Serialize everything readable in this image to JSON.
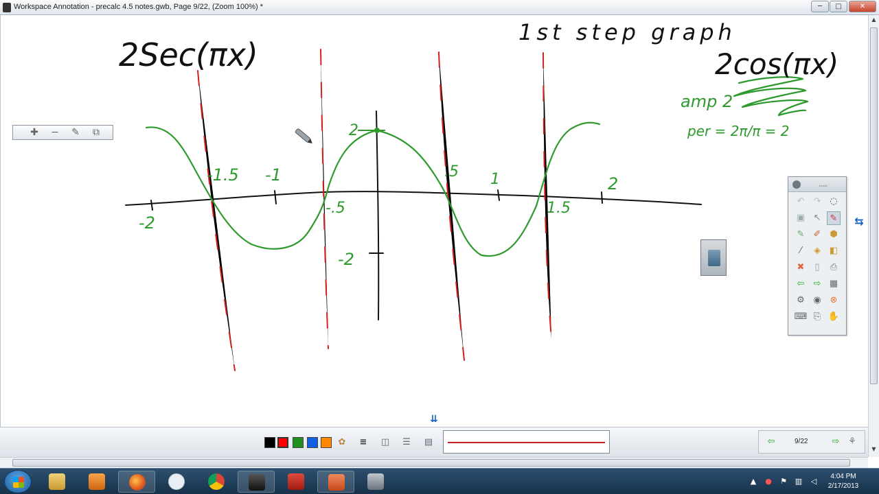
{
  "window": {
    "title": "Workspace Annotation - precalc 4.5 notes.gwb, Page 9/22, (Zoom 100%) *",
    "minimize_glyph": "─",
    "maximize_glyph": "□",
    "close_glyph": "✕"
  },
  "handwriting": {
    "main_function": "2Sec(πx)",
    "step_note": "1st step graph",
    "helper_function": "2cos(πx)",
    "amplitude_note": "amp 2",
    "period_note": "per = 2π/π = 2",
    "axis_labels": {
      "x_neg2": "-2",
      "x_neg1_5": "-1.5",
      "x_neg1": "-1",
      "x_neg0_5": "-.5",
      "x_pos0_5": ".5",
      "x_pos1": "1",
      "x_pos1_5": "1.5",
      "x_pos2": "2",
      "y_pos2": "2",
      "y_neg2": "-2"
    },
    "colors": {
      "ink_black": "#111111",
      "ink_green": "#2e9a2e",
      "ink_red": "#d21f1f"
    }
  },
  "float_toolbar": {
    "add_glyph": "✚",
    "remove_glyph": "−",
    "edit_glyph": "✎",
    "copy_glyph": "⧉"
  },
  "bottom_toolbar": {
    "colors": [
      "#000000",
      "#ff0000",
      "#1f8f1f",
      "#1060e0",
      "#ff8800"
    ],
    "page_indicator": "9/22",
    "prev_glyph": "⇦",
    "next_glyph": "⇨",
    "expand_glyph": "⇊"
  },
  "side_palette": {
    "grip": "········",
    "toggle_glyph": "⇆"
  },
  "taskbar": {
    "time": "4:04 PM",
    "date": "2/17/2013",
    "tray_up": "▲"
  }
}
